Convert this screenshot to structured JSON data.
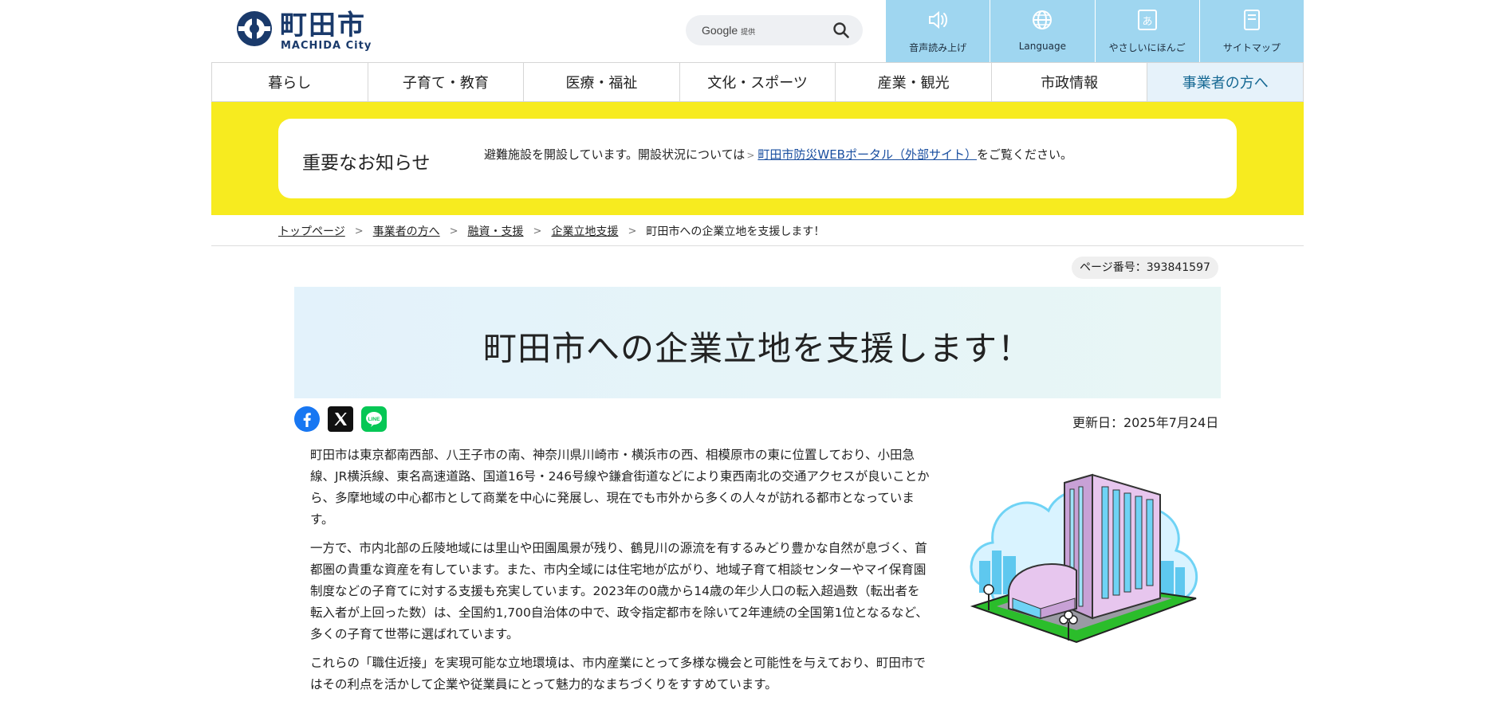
{
  "header": {
    "logo_jp": "町田市",
    "logo_en": "MACHIDA City",
    "search_brand": "Google",
    "search_brand_sub": "提供",
    "tools": [
      {
        "label": "音声読み上げ",
        "icon": "speaker-icon"
      },
      {
        "label": "Language",
        "icon": "globe-icon"
      },
      {
        "label": "やさしいにほんご",
        "icon": "hiragana-a-icon"
      },
      {
        "label": "サイトマップ",
        "icon": "sitemap-icon"
      }
    ]
  },
  "gnav": [
    "暮らし",
    "子育て・教育",
    "医療・福祉",
    "文化・スポーツ",
    "産業・観光",
    "市政情報",
    "事業者の方へ"
  ],
  "notice": {
    "title": "重要なお知らせ",
    "text_before": "避難施設を開設しています。開設状況については",
    "arrow": ">",
    "link": "町田市防災WEBポータル（外部サイト）",
    "text_after": "をご覧ください。"
  },
  "breadcrumb": {
    "items": [
      "トップページ",
      "事業者の方へ",
      "融資・支援",
      "企業立地支援"
    ],
    "separator": ">",
    "current": "町田市への企業立地を支援します！"
  },
  "page_number": "ページ番号：393841597",
  "title": "町田市への企業立地を支援します！",
  "updated": "更新日：2025年7月24日",
  "share": [
    "facebook-icon",
    "x-icon",
    "line-icon"
  ],
  "paragraphs": [
    "町田市は東京都南西部、八王子市の南、神奈川県川崎市・横浜市の西、相模原市の東に位置しており、小田急線、JR横浜線、東名高速道路、国道16号・246号線や鎌倉街道などにより東西南北の交通アクセスが良いことから、多摩地域の中心都市として商業を中心に発展し、現在でも市外から多くの人々が訪れる都市となっています。",
    "一方で、市内北部の丘陵地域には里山や田園風景が残り、鶴見川の源流を有するみどり豊かな自然が息づく、首都圏の貴重な資産を有しています。また、市内全域には住宅地が広がり、地域子育て相談センターやマイ保育園制度などの子育てに対する支援も充実しています。2023年の0歳から14歳の年少人口の転入超過数（転出者を転入者が上回った数）は、全国約1,700自治体の中で、政令指定都市を除いて2年連続の全国第1位となるなど、多くの子育て世帯に選ばれています。",
    "これらの「職住近接」を実現可能な立地環境は、市内産業にとって多様な機会と可能性を与えており、町田市ではその利点を活かして企業や従業員にとって魅力的なまちづくりをすすめています。"
  ],
  "colors": {
    "tool_bg": "#9fd6f0",
    "notice_band": "#f7eb1f",
    "link": "#1a4fa0",
    "brand_navy": "#1a3a6b",
    "gnav_active_bg": "#e6f2fa"
  }
}
